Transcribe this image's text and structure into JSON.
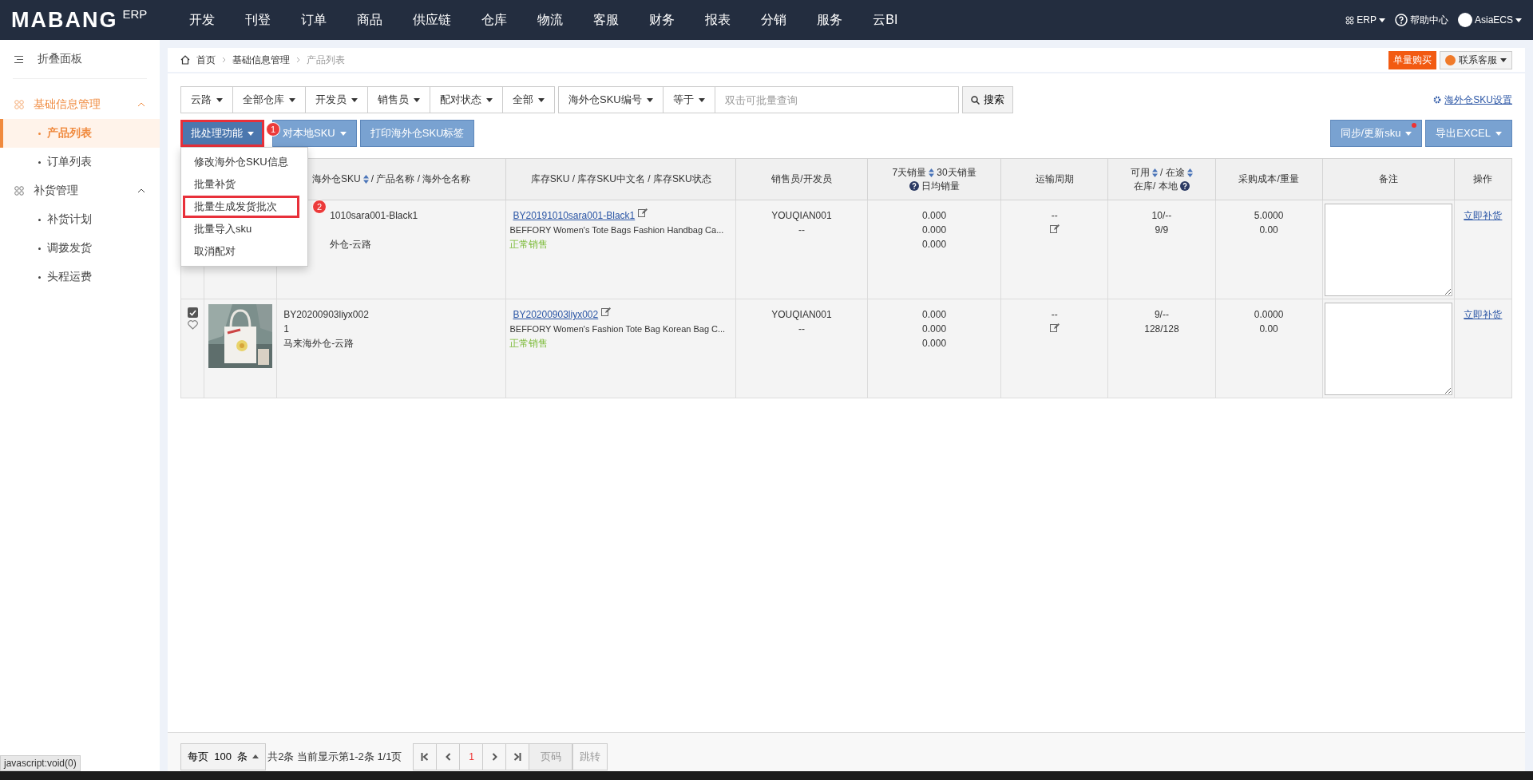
{
  "topnav": {
    "logo": "MABANG",
    "logo_suffix": "ERP",
    "items": [
      {
        "label": "开发",
        "selected": false
      },
      {
        "label": "刊登",
        "selected": false
      },
      {
        "label": "订单",
        "selected": false
      },
      {
        "label": "商品",
        "selected": false
      },
      {
        "label": "供应链",
        "selected": false
      },
      {
        "label": "仓库",
        "selected": false
      },
      {
        "label": "物流",
        "selected": false
      },
      {
        "label": "客服",
        "selected": false
      },
      {
        "label": "财务",
        "selected": false
      },
      {
        "label": "报表",
        "selected": false
      },
      {
        "label": "分销",
        "selected": false
      },
      {
        "label": "服务",
        "selected": false
      },
      {
        "label": "云BI",
        "selected": false
      }
    ],
    "erp": "ERP",
    "help": "帮助中心",
    "user": "AsiaECS"
  },
  "sidebar": {
    "collapse": "折叠面板",
    "groups": [
      {
        "label": "基础信息管理",
        "selected": true,
        "expanded": true,
        "children": [
          {
            "label": "产品列表",
            "selected": true
          },
          {
            "label": "订单列表",
            "selected": false
          }
        ]
      },
      {
        "label": "补货管理",
        "selected": false,
        "expanded": true,
        "children": [
          {
            "label": "补货计划",
            "selected": false
          },
          {
            "label": "调拨发货",
            "selected": false
          },
          {
            "label": "头程运费",
            "selected": false
          }
        ]
      }
    ]
  },
  "breadcrumb": [
    "首页",
    "基础信息管理",
    "产品列表"
  ],
  "header_buttons": {
    "buy": "单量购买",
    "service": "联系客服"
  },
  "filters": [
    "云路",
    "全部仓库",
    "开发员",
    "销售员",
    "配对状态",
    "全部"
  ],
  "search": {
    "field": "海外仓SKU编号",
    "operator": "等于",
    "placeholder": "双击可批量查询",
    "button": "搜索"
  },
  "settings_link": "海外仓SKU设置",
  "actions": [
    {
      "label": "批处理功能",
      "highlighted": true,
      "badge": "1",
      "dropdown": true
    },
    {
      "label": "对本地SKU",
      "highlighted": false,
      "dropdown": true
    },
    {
      "label": "打印海外仓SKU标签",
      "highlighted": false,
      "dropdown": false
    }
  ],
  "right_actions": [
    {
      "label": "同步/更新sku",
      "dropdown": true,
      "notify": true
    },
    {
      "label": "导出EXCEL",
      "dropdown": true,
      "notify": false
    }
  ],
  "menu": [
    {
      "label": "修改海外仓SKU信息",
      "highlighted": false
    },
    {
      "label": "批量补货",
      "highlighted": false
    },
    {
      "label": "批量生成发货批次",
      "highlighted": true,
      "badge": "2"
    },
    {
      "label": "批量导入sku",
      "highlighted": false
    },
    {
      "label": "取消配对",
      "highlighted": false
    }
  ],
  "columns": [
    {
      "lines": [
        [
          {
            "text": "海外仓SKU",
            "sort": true
          },
          {
            "text": "/ 产品名称 / 海外仓名称"
          }
        ]
      ]
    },
    {
      "lines": [
        [
          {
            "text": "库存SKU / 库存SKU中文名 / 库存SKU状态"
          }
        ]
      ]
    },
    {
      "lines": [
        [
          {
            "text": "销售员/开发员"
          }
        ]
      ]
    },
    {
      "lines": [
        [
          {
            "text": "7天销量",
            "sort": true
          },
          {
            "text": "30天销量"
          }
        ],
        [
          {
            "text": "日均销量",
            "help": true
          }
        ]
      ]
    },
    {
      "lines": [
        [
          {
            "text": "运输周期"
          }
        ]
      ]
    },
    {
      "lines": [
        [
          {
            "text": "可用",
            "sort": true
          },
          {
            "text": "/ 在途",
            "sort": true
          }
        ],
        [
          {
            "text": "在库/ 本地",
            "help_after": true
          }
        ]
      ]
    },
    {
      "lines": [
        [
          {
            "text": "采购成本/重量"
          }
        ]
      ]
    },
    {
      "lines": [
        [
          {
            "text": "备注"
          }
        ]
      ]
    },
    {
      "lines": [
        [
          {
            "text": "操作"
          }
        ]
      ]
    }
  ],
  "rows": [
    {
      "covered": true,
      "sku": "1010sara001-Black1",
      "warehouse": "外仓-云路",
      "stock_sku": "BY20191010sara001-Black1",
      "stock_name": "BEFFORY Women's Tote Bags Fashion Handbag Ca...",
      "status": "正常销售",
      "seller": "YOUQIAN001",
      "developer": "--",
      "sales": [
        "0.000",
        "0.000",
        "0.000"
      ],
      "transport": "--",
      "available": "10/--",
      "stock": "9/9",
      "cost": "5.0000",
      "weight": "0.00",
      "action": "立即补货"
    },
    {
      "covered": false,
      "checked": true,
      "favorite": false,
      "sku": "BY20200903liyx002",
      "name": "1",
      "warehouse": "马来海外仓-云路",
      "stock_sku": "BY20200903liyx002",
      "stock_name": "BEFFORY Women's Fashion Tote Bag Korean Bag C...",
      "status": "正常销售",
      "seller": "YOUQIAN001",
      "developer": "--",
      "sales": [
        "0.000",
        "0.000",
        "0.000"
      ],
      "transport": "--",
      "available": "9/--",
      "stock": "128/128",
      "cost": "0.0000",
      "weight": "0.00",
      "action": "立即补货"
    }
  ],
  "pagination": {
    "per_page": "每页  100  条",
    "info": "共2条 当前显示第1-2条 1/1页",
    "page": "1",
    "page_placeholder": "页码",
    "jump": "跳转"
  },
  "status_bar": "javascript:void(0)"
}
